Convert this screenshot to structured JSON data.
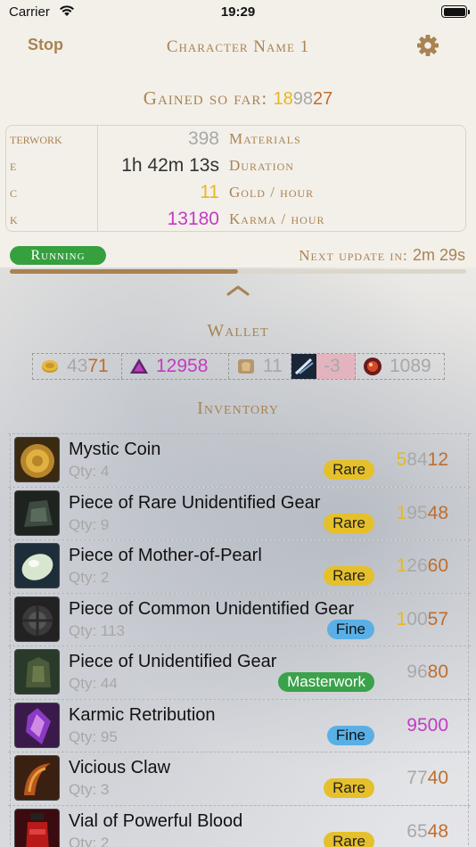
{
  "status_bar": {
    "carrier": "Carrier",
    "time": "19:29"
  },
  "nav": {
    "stop_label": "Stop",
    "title": "Character Name 1",
    "settings_icon": "gear-icon"
  },
  "gained": {
    "label": "Gained so far:",
    "gold": "18",
    "silver": "98",
    "copper": "27"
  },
  "stats": [
    {
      "left_cut": "terwork",
      "value": "398",
      "label": "Materials",
      "value_color": "#a8a8a8"
    },
    {
      "left_cut": "e",
      "value": "1h 42m 13s",
      "label": "Duration",
      "value_color": "#333333"
    },
    {
      "left_cut": "c",
      "value": "11",
      "label": "Gold / hour",
      "value_color": "#e6b822"
    },
    {
      "left_cut": "k",
      "value": "13180",
      "label": "Karma / hour",
      "value_color": "#c43bc4"
    }
  ],
  "run_status": {
    "label": "Running",
    "next_update_label": "Next update in:",
    "next_update_time": "2m 29s",
    "progress_fraction": 0.5
  },
  "wallet": {
    "title": "Wallet",
    "currencies": [
      {
        "icon": "coin-icon",
        "gold": "",
        "silver": "43",
        "copper": "71",
        "type": "money"
      },
      {
        "icon": "karma-icon",
        "value": "12958",
        "color": "#c43bc4",
        "type": "plain"
      },
      {
        "icon": "laurel-icon",
        "value": "11",
        "color": "#a8a8a8",
        "type": "plain"
      },
      {
        "icon": "spirit-shard-icon",
        "value": "-3",
        "color": "#a8a8a8",
        "type": "negative"
      },
      {
        "icon": "gem-icon",
        "value": "1089",
        "color": "#a8a8a8",
        "type": "plain"
      }
    ]
  },
  "inventory": {
    "title": "Inventory",
    "items": [
      {
        "name": "Mystic Coin",
        "qty": "Qty: 4",
        "rarity": "Rare",
        "rarity_class": "rare",
        "gold": "5",
        "silver": "84",
        "copper": "12",
        "icon": "mystic-coin-icon",
        "thumb": "#3a2a12"
      },
      {
        "name": "Piece of Rare Unidentified Gear",
        "qty": "Qty: 9",
        "rarity": "Rare",
        "rarity_class": "rare",
        "gold": "1",
        "silver": "95",
        "copper": "48",
        "icon": "rare-gear-icon",
        "thumb": "#1e2320"
      },
      {
        "name": "Piece of Mother-of-Pearl",
        "qty": "Qty: 2",
        "rarity": "Rare",
        "rarity_class": "rare",
        "gold": "1",
        "silver": "26",
        "copper": "60",
        "icon": "pearl-icon",
        "thumb": "#1d2e3a"
      },
      {
        "name": "Piece of Common Unidentified Gear",
        "qty": "Qty: 113",
        "rarity": "Fine",
        "rarity_class": "fine",
        "gold": "1",
        "silver": "00",
        "copper": "57",
        "icon": "common-gear-icon",
        "thumb": "#222222"
      },
      {
        "name": "Piece of Unidentified Gear",
        "qty": "Qty: 44",
        "rarity": "Masterwork",
        "rarity_class": "masterwork",
        "gold": "",
        "silver": "96",
        "copper": "80",
        "icon": "unid-gear-icon",
        "thumb": "#2a3a2a"
      },
      {
        "name": "Karmic Retribution",
        "qty": "Qty: 95",
        "rarity": "Fine",
        "rarity_class": "fine",
        "karma": "9500",
        "icon": "karmic-retribution-icon",
        "thumb": "#3a1a4a"
      },
      {
        "name": "Vicious Claw",
        "qty": "Qty: 3",
        "rarity": "Rare",
        "rarity_class": "rare",
        "gold": "",
        "silver": "77",
        "copper": "40",
        "icon": "vicious-claw-icon",
        "thumb": "#3a2010"
      },
      {
        "name": "Vial of Powerful Blood",
        "qty": "Qty: 2",
        "rarity": "Rare",
        "rarity_class": "rare",
        "gold": "",
        "silver": "65",
        "copper": "48",
        "icon": "blood-vial-icon",
        "thumb": "#3a0c10"
      }
    ]
  }
}
